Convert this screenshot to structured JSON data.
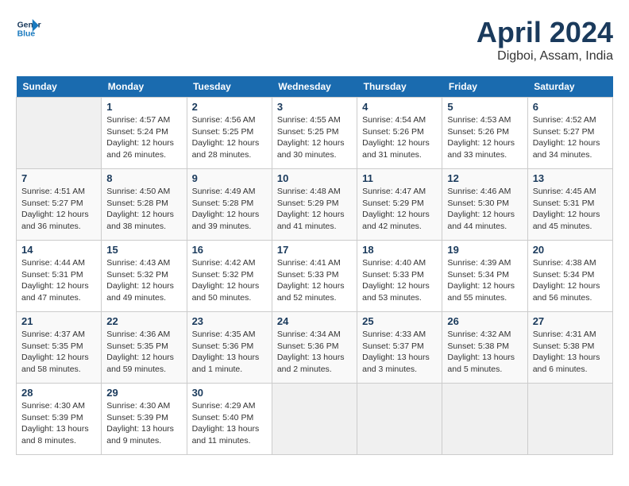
{
  "header": {
    "logo_line1": "General",
    "logo_line2": "Blue",
    "month": "April 2024",
    "location": "Digboi, Assam, India"
  },
  "weekdays": [
    "Sunday",
    "Monday",
    "Tuesday",
    "Wednesday",
    "Thursday",
    "Friday",
    "Saturday"
  ],
  "weeks": [
    [
      {
        "day": "",
        "sunrise": "",
        "sunset": "",
        "daylight": ""
      },
      {
        "day": "1",
        "sunrise": "Sunrise: 4:57 AM",
        "sunset": "Sunset: 5:24 PM",
        "daylight": "Daylight: 12 hours and 26 minutes."
      },
      {
        "day": "2",
        "sunrise": "Sunrise: 4:56 AM",
        "sunset": "Sunset: 5:25 PM",
        "daylight": "Daylight: 12 hours and 28 minutes."
      },
      {
        "day": "3",
        "sunrise": "Sunrise: 4:55 AM",
        "sunset": "Sunset: 5:25 PM",
        "daylight": "Daylight: 12 hours and 30 minutes."
      },
      {
        "day": "4",
        "sunrise": "Sunrise: 4:54 AM",
        "sunset": "Sunset: 5:26 PM",
        "daylight": "Daylight: 12 hours and 31 minutes."
      },
      {
        "day": "5",
        "sunrise": "Sunrise: 4:53 AM",
        "sunset": "Sunset: 5:26 PM",
        "daylight": "Daylight: 12 hours and 33 minutes."
      },
      {
        "day": "6",
        "sunrise": "Sunrise: 4:52 AM",
        "sunset": "Sunset: 5:27 PM",
        "daylight": "Daylight: 12 hours and 34 minutes."
      }
    ],
    [
      {
        "day": "7",
        "sunrise": "Sunrise: 4:51 AM",
        "sunset": "Sunset: 5:27 PM",
        "daylight": "Daylight: 12 hours and 36 minutes."
      },
      {
        "day": "8",
        "sunrise": "Sunrise: 4:50 AM",
        "sunset": "Sunset: 5:28 PM",
        "daylight": "Daylight: 12 hours and 38 minutes."
      },
      {
        "day": "9",
        "sunrise": "Sunrise: 4:49 AM",
        "sunset": "Sunset: 5:28 PM",
        "daylight": "Daylight: 12 hours and 39 minutes."
      },
      {
        "day": "10",
        "sunrise": "Sunrise: 4:48 AM",
        "sunset": "Sunset: 5:29 PM",
        "daylight": "Daylight: 12 hours and 41 minutes."
      },
      {
        "day": "11",
        "sunrise": "Sunrise: 4:47 AM",
        "sunset": "Sunset: 5:29 PM",
        "daylight": "Daylight: 12 hours and 42 minutes."
      },
      {
        "day": "12",
        "sunrise": "Sunrise: 4:46 AM",
        "sunset": "Sunset: 5:30 PM",
        "daylight": "Daylight: 12 hours and 44 minutes."
      },
      {
        "day": "13",
        "sunrise": "Sunrise: 4:45 AM",
        "sunset": "Sunset: 5:31 PM",
        "daylight": "Daylight: 12 hours and 45 minutes."
      }
    ],
    [
      {
        "day": "14",
        "sunrise": "Sunrise: 4:44 AM",
        "sunset": "Sunset: 5:31 PM",
        "daylight": "Daylight: 12 hours and 47 minutes."
      },
      {
        "day": "15",
        "sunrise": "Sunrise: 4:43 AM",
        "sunset": "Sunset: 5:32 PM",
        "daylight": "Daylight: 12 hours and 49 minutes."
      },
      {
        "day": "16",
        "sunrise": "Sunrise: 4:42 AM",
        "sunset": "Sunset: 5:32 PM",
        "daylight": "Daylight: 12 hours and 50 minutes."
      },
      {
        "day": "17",
        "sunrise": "Sunrise: 4:41 AM",
        "sunset": "Sunset: 5:33 PM",
        "daylight": "Daylight: 12 hours and 52 minutes."
      },
      {
        "day": "18",
        "sunrise": "Sunrise: 4:40 AM",
        "sunset": "Sunset: 5:33 PM",
        "daylight": "Daylight: 12 hours and 53 minutes."
      },
      {
        "day": "19",
        "sunrise": "Sunrise: 4:39 AM",
        "sunset": "Sunset: 5:34 PM",
        "daylight": "Daylight: 12 hours and 55 minutes."
      },
      {
        "day": "20",
        "sunrise": "Sunrise: 4:38 AM",
        "sunset": "Sunset: 5:34 PM",
        "daylight": "Daylight: 12 hours and 56 minutes."
      }
    ],
    [
      {
        "day": "21",
        "sunrise": "Sunrise: 4:37 AM",
        "sunset": "Sunset: 5:35 PM",
        "daylight": "Daylight: 12 hours and 58 minutes."
      },
      {
        "day": "22",
        "sunrise": "Sunrise: 4:36 AM",
        "sunset": "Sunset: 5:35 PM",
        "daylight": "Daylight: 12 hours and 59 minutes."
      },
      {
        "day": "23",
        "sunrise": "Sunrise: 4:35 AM",
        "sunset": "Sunset: 5:36 PM",
        "daylight": "Daylight: 13 hours and 1 minute."
      },
      {
        "day": "24",
        "sunrise": "Sunrise: 4:34 AM",
        "sunset": "Sunset: 5:36 PM",
        "daylight": "Daylight: 13 hours and 2 minutes."
      },
      {
        "day": "25",
        "sunrise": "Sunrise: 4:33 AM",
        "sunset": "Sunset: 5:37 PM",
        "daylight": "Daylight: 13 hours and 3 minutes."
      },
      {
        "day": "26",
        "sunrise": "Sunrise: 4:32 AM",
        "sunset": "Sunset: 5:38 PM",
        "daylight": "Daylight: 13 hours and 5 minutes."
      },
      {
        "day": "27",
        "sunrise": "Sunrise: 4:31 AM",
        "sunset": "Sunset: 5:38 PM",
        "daylight": "Daylight: 13 hours and 6 minutes."
      }
    ],
    [
      {
        "day": "28",
        "sunrise": "Sunrise: 4:30 AM",
        "sunset": "Sunset: 5:39 PM",
        "daylight": "Daylight: 13 hours and 8 minutes."
      },
      {
        "day": "29",
        "sunrise": "Sunrise: 4:30 AM",
        "sunset": "Sunset: 5:39 PM",
        "daylight": "Daylight: 13 hours and 9 minutes."
      },
      {
        "day": "30",
        "sunrise": "Sunrise: 4:29 AM",
        "sunset": "Sunset: 5:40 PM",
        "daylight": "Daylight: 13 hours and 11 minutes."
      },
      {
        "day": "",
        "sunrise": "",
        "sunset": "",
        "daylight": ""
      },
      {
        "day": "",
        "sunrise": "",
        "sunset": "",
        "daylight": ""
      },
      {
        "day": "",
        "sunrise": "",
        "sunset": "",
        "daylight": ""
      },
      {
        "day": "",
        "sunrise": "",
        "sunset": "",
        "daylight": ""
      }
    ]
  ]
}
